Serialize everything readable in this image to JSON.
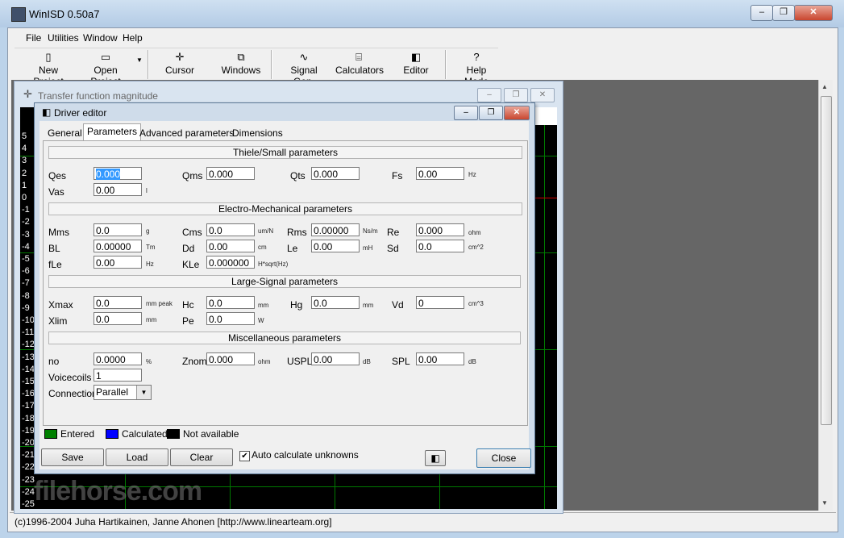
{
  "app": {
    "title": "WinISD 0.50a7",
    "min_glyph": "‒",
    "max_glyph": "❐",
    "close_glyph": "✕"
  },
  "menu": [
    "File",
    "Utilities",
    "Window",
    "Help"
  ],
  "toolbar": {
    "new_project": "New Project",
    "open_project": "Open Project",
    "cursor": "Cursor",
    "windows": "Windows",
    "signal_gen": "Signal Gen.",
    "calculators": "Calculators",
    "editor": "Editor",
    "help_mode": "Help Mode",
    "help_glyph": "?"
  },
  "tf_window": {
    "title": "Transfer function magnitude",
    "y_ticks": [
      "5",
      "4",
      "3",
      "2",
      "1",
      "0",
      "-1",
      "-2",
      "-3",
      "-4",
      "-5",
      "-6",
      "-7",
      "-8",
      "-9",
      "-10",
      "-11",
      "-12",
      "-13",
      "-14",
      "-15",
      "-16",
      "-17",
      "-18",
      "-19",
      "-20",
      "-21",
      "-22",
      "-23",
      "-24",
      "-25"
    ]
  },
  "driver_editor": {
    "title": "Driver editor",
    "tabs": [
      "General",
      "Parameters",
      "Advanced parameters",
      "Dimensions"
    ],
    "sections": {
      "ts": "Thiele/Small parameters",
      "em": "Electro-Mechanical parameters",
      "ls": "Large-Signal parameters",
      "misc": "Miscellaneous parameters"
    },
    "fields": {
      "qes": {
        "label": "Qes",
        "value": "0.000"
      },
      "qms": {
        "label": "Qms",
        "value": "0.000"
      },
      "qts": {
        "label": "Qts",
        "value": "0.000"
      },
      "fs": {
        "label": "Fs",
        "value": "0.00",
        "unit": "Hz"
      },
      "vas": {
        "label": "Vas",
        "value": "0.00",
        "unit": "l"
      },
      "mms": {
        "label": "Mms",
        "value": "0.0",
        "unit": "g"
      },
      "cms": {
        "label": "Cms",
        "value": "0.0",
        "unit": "um/N"
      },
      "rms": {
        "label": "Rms",
        "value": "0.00000",
        "unit": "Ns/m"
      },
      "re": {
        "label": "Re",
        "value": "0.000",
        "unit": "ohm"
      },
      "bl": {
        "label": "BL",
        "value": "0.00000",
        "unit": "Tm"
      },
      "dd": {
        "label": "Dd",
        "value": "0.00",
        "unit": "cm"
      },
      "le": {
        "label": "Le",
        "value": "0.00",
        "unit": "mH"
      },
      "sd": {
        "label": "Sd",
        "value": "0.0",
        "unit": "cm^2"
      },
      "fle": {
        "label": "fLe",
        "value": "0.00",
        "unit": "Hz"
      },
      "kle": {
        "label": "KLe",
        "value": "0.000000",
        "unit": "H*sqrt(Hz)"
      },
      "xmax": {
        "label": "Xmax",
        "value": "0.0",
        "unit": "mm  peak"
      },
      "hc": {
        "label": "Hc",
        "value": "0.0",
        "unit": "mm"
      },
      "hg": {
        "label": "Hg",
        "value": "0.0",
        "unit": "mm"
      },
      "vd": {
        "label": "Vd",
        "value": "0",
        "unit": "cm^3"
      },
      "xlim": {
        "label": "Xlim",
        "value": "0.0",
        "unit": "mm"
      },
      "pe": {
        "label": "Pe",
        "value": "0.0",
        "unit": "W"
      },
      "no": {
        "label": "no",
        "value": "0.0000",
        "unit": "%"
      },
      "znom": {
        "label": "Znom",
        "value": "0.000",
        "unit": "ohm"
      },
      "uspl": {
        "label": "USPL",
        "value": "0.00",
        "unit": "dB"
      },
      "spl": {
        "label": "SPL",
        "value": "0.00",
        "unit": "dB"
      },
      "voicecoils": {
        "label": "Voicecoils",
        "value": "1"
      },
      "connection": {
        "label": "Connection",
        "value": "Parallel"
      }
    },
    "legend": {
      "entered": "Entered",
      "calculated": "Calculated",
      "not_available": "Not available",
      "colors": {
        "entered": "#008000",
        "calculated": "#0000ff",
        "not_available": "#000000"
      }
    },
    "buttons": {
      "save": "Save",
      "load": "Load",
      "clear": "Clear",
      "close": "Close"
    },
    "auto_calc": {
      "label": "Auto calculate unknowns",
      "checked": true,
      "mark": "✔"
    }
  },
  "status": "(c)1996-2004 Juha Hartikainen, Janne Ahonen [http://www.linearteam.org]",
  "watermark": "filehorse.com"
}
